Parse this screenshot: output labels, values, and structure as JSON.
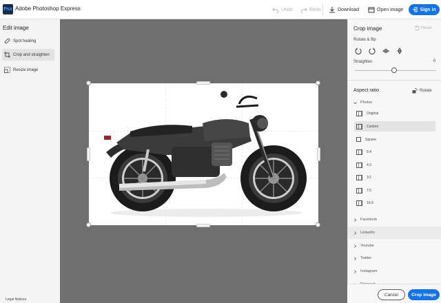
{
  "header": {
    "logo_text": "Psx",
    "app_title": "Adobe Photoshop Express",
    "undo_label": "Undo",
    "redo_label": "Redo",
    "download_label": "Download",
    "open_image_label": "Open image",
    "sign_in_label": "Sign in"
  },
  "left_panel": {
    "heading": "Edit image",
    "items": [
      {
        "label": "Spot healing",
        "icon": "bandage-icon",
        "active": false
      },
      {
        "label": "Crop and straighten",
        "icon": "crop-icon",
        "active": true
      },
      {
        "label": "Resize image",
        "icon": "resize-icon",
        "active": false
      }
    ],
    "legal_label": "Legal Notices"
  },
  "right_panel": {
    "title": "Crop image",
    "reset_label": "Reset",
    "rotate_flip_label": "Rotate & flip",
    "straighten_label": "Straighten",
    "straighten_value": "0",
    "straighten_level": 0.5,
    "aspect_ratio_label": "Aspect ratio",
    "rotate_label": "Rotate",
    "photos_label": "Photos",
    "options": [
      {
        "label": "Original",
        "selected": false
      },
      {
        "label": "Custom",
        "selected": true
      },
      {
        "label": "Square",
        "selected": false
      },
      {
        "label": "5:4",
        "selected": false
      },
      {
        "label": "4:3",
        "selected": false
      },
      {
        "label": "3:2",
        "selected": false
      },
      {
        "label": "7:5",
        "selected": false
      },
      {
        "label": "16:9",
        "selected": false
      }
    ],
    "socials": [
      {
        "label": "Facebook",
        "highlight": false
      },
      {
        "label": "LinkedIn",
        "highlight": true
      },
      {
        "label": "Youtube",
        "highlight": false
      },
      {
        "label": "Twitter",
        "highlight": false
      },
      {
        "label": "Instagram",
        "highlight": false
      },
      {
        "label": "Pinterest",
        "highlight": false
      }
    ]
  },
  "footer": {
    "cancel_label": "Cancel",
    "crop_label": "Crop image"
  },
  "colors": {
    "accent": "#1473e6",
    "canvas": "#6f6f6f"
  }
}
